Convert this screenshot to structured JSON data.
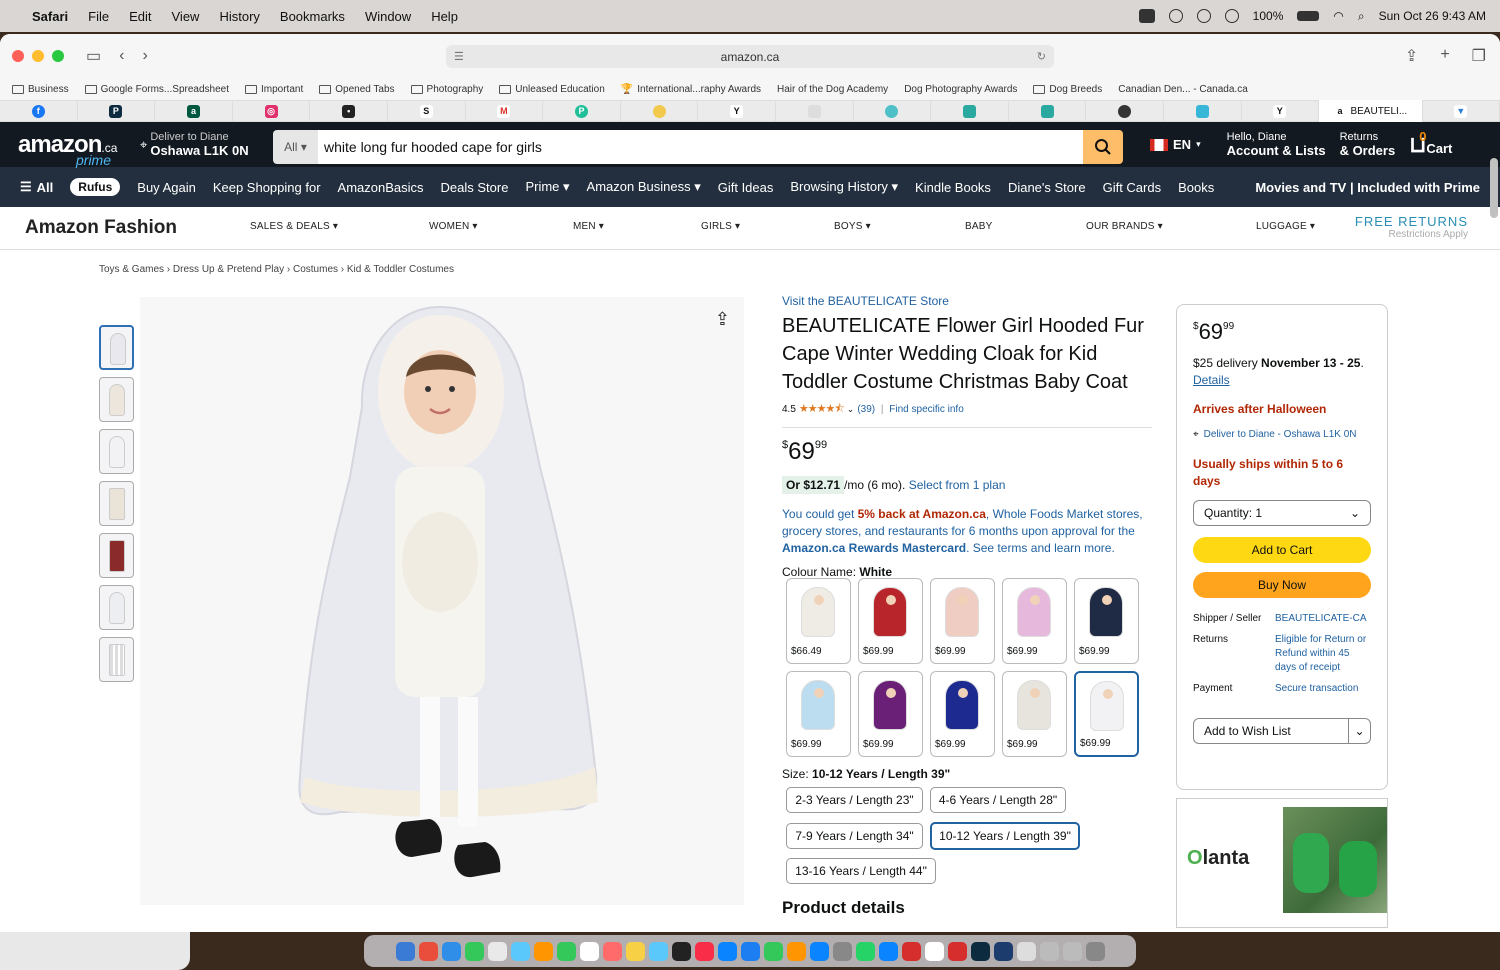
{
  "menubar": {
    "app": "Safari",
    "items": [
      "File",
      "Edit",
      "View",
      "History",
      "Bookmarks",
      "Window",
      "Help"
    ],
    "battery": "100%",
    "datetime": "Sun Oct 26  9:43 AM"
  },
  "browser": {
    "url": "amazon.ca",
    "bookmarks": [
      "Business",
      "Google Forms...Spreadsheet",
      "Important",
      "Opened Tabs",
      "Photography",
      "Unleased Education",
      "International...raphy Awards",
      "Hair of the Dog Academy",
      "Dog Photography Awards",
      "Dog Breeds",
      "Canadian Den... - Canada.ca"
    ],
    "active_tab": "BEAUTELI..."
  },
  "amazon": {
    "logo": "amazon",
    "logo_ca": ".ca",
    "logo_prime": "prime",
    "deliver_line1": "Deliver to Diane",
    "deliver_line2": "Oshawa L1K 0N",
    "search_category": "All",
    "search_value": "white long fur hooded cape for girls",
    "language": "EN",
    "account_line1": "Hello, Diane",
    "account_line2": "Account & Lists",
    "returns_line1": "Returns",
    "returns_line2": "& Orders",
    "cart_count": "0",
    "cart_label": "Cart"
  },
  "nav": {
    "all": "All",
    "rufus": "Rufus",
    "items": [
      "Buy Again",
      "Keep Shopping for",
      "AmazonBasics",
      "Deals Store",
      "Prime",
      "Amazon Business",
      "Gift Ideas",
      "Browsing History",
      "Kindle Books",
      "Diane's Store",
      "Gift Cards",
      "Books"
    ],
    "right": "Movies and TV | Included with Prime"
  },
  "fashion": {
    "title": "Amazon Fashion",
    "items": [
      "SALES & DEALS",
      "WOMEN",
      "MEN",
      "GIRLS",
      "BOYS",
      "BABY",
      "OUR BRANDS",
      "LUGGAGE"
    ],
    "free_returns": "FREE RETURNS",
    "restrictions": "Restrictions Apply"
  },
  "breadcrumb": [
    "Toys & Games",
    "Dress Up & Pretend Play",
    "Costumes",
    "Kid & Toddler Costumes"
  ],
  "product": {
    "store_link": "Visit the BEAUTELICATE Store",
    "title": "BEAUTELICATE Flower Girl Hooded Fur Cape Winter Wedding Cloak for Kid Toddler Costume Christmas Baby Coat",
    "rating": "4.5",
    "review_count": "(39)",
    "find_info": "Find specific info",
    "price_whole": "69",
    "price_frac": "99",
    "plan_amount": "Or $12.71",
    "plan_rest": "/mo (6 mo).",
    "plan_link": "Select from 1 plan",
    "cashback_1": "You could get ",
    "cashback_red": "5% back at Amazon.ca",
    "cashback_2": ", Whole Foods Market stores, grocery stores, and restaurants for 6 months upon approval for the ",
    "cashback_bold": "Amazon.ca Rewards Mastercard",
    "cashback_3": ". See terms and learn more.",
    "colour_label": "Colour Name: ",
    "colour_value": "White",
    "swatches": [
      {
        "price": "$66.49",
        "color": "#efece6"
      },
      {
        "price": "$69.99",
        "color": "#b8262b"
      },
      {
        "price": "$69.99",
        "color": "#efcdc3"
      },
      {
        "price": "$69.99",
        "color": "#e6b8dc"
      },
      {
        "price": "$69.99",
        "color": "#1f2a44"
      },
      {
        "price": "$69.99",
        "color": "#bcdcf0"
      },
      {
        "price": "$69.99",
        "color": "#6b2077"
      },
      {
        "price": "$69.99",
        "color": "#1d2a8f"
      },
      {
        "price": "$69.99",
        "color": "#e7e4de"
      },
      {
        "price": "$69.99",
        "color": "#f2f2f4"
      }
    ],
    "size_label": "Size: ",
    "size_value": "10-12 Years / Length 39\"",
    "sizes": [
      "2-3 Years / Length 23\"",
      "4-6 Years / Length 28\"",
      "7-9 Years / Length 34\"",
      "10-12 Years / Length 39\"",
      "13-16 Years / Length 44\""
    ],
    "details_heading": "Product details"
  },
  "buybox": {
    "price_whole": "69",
    "price_frac": "99",
    "delivery_text": "$25 delivery ",
    "delivery_date": "November 13 - 25",
    "details_link": "Details",
    "arrives": "Arrives after Halloween",
    "deliver_to": "Deliver to Diane - Oshawa L1K 0N",
    "ships": "Usually ships within 5 to 6 days",
    "quantity": "Quantity:  1",
    "add_to_cart": "Add to Cart",
    "buy_now": "Buy Now",
    "shipper_label": "Shipper / Seller",
    "shipper_value": "BEAUTELICATE-CA",
    "returns_label": "Returns",
    "returns_value": "Eligible for Return or Refund within 45 days of receipt",
    "payment_label": "Payment",
    "payment_value": "Secure transaction",
    "wish_list": "Add to Wish List"
  },
  "ad": {
    "brand_a": "",
    "brand_o": "O",
    "brand_b": "lanta"
  }
}
